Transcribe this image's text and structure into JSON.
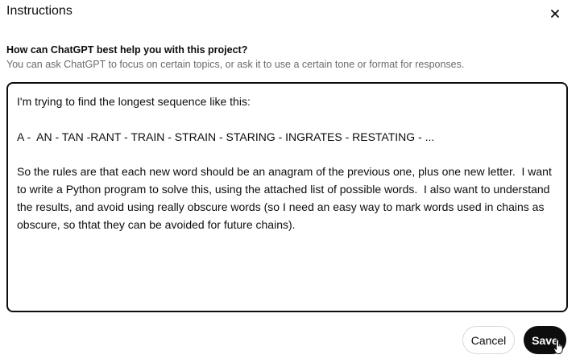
{
  "dialog": {
    "title": "Instructions",
    "close_icon": "close-icon",
    "question": "How can ChatGPT best help you with this project?",
    "hint": "You can ask ChatGPT to focus on certain topics, or ask it to use a certain tone or format for responses.",
    "instructions_text": "I'm trying to find the longest sequence like this:\n\nA -  AN - TAN -RANT - TRAIN - STRAIN - STARING - INGRATES - RESTATING - ...\n\nSo the rules are that each new word should be an anagram of the previous one, plus one new letter.  I want to write a Python program to solve this, using the attached list of possible words.  I also want to understand the results, and avoid using really obscure words (so I need an easy way to mark words used in chains as obscure, so thtat they can be avoided for future chains).",
    "cancel_label": "Cancel",
    "save_label": "Save"
  }
}
